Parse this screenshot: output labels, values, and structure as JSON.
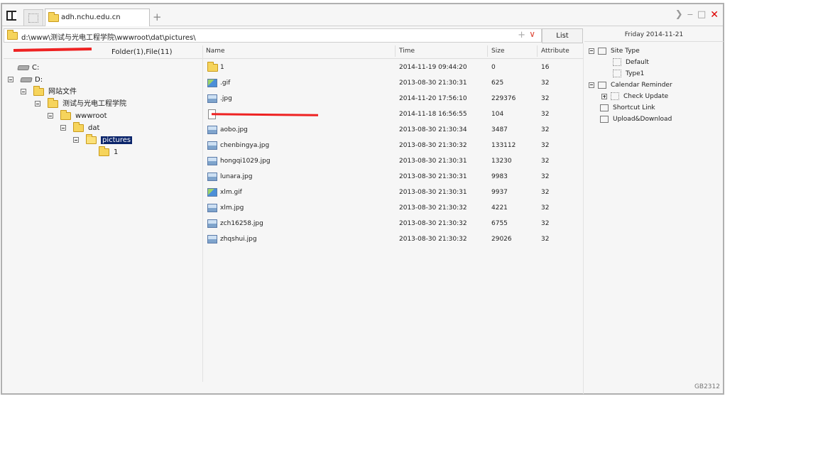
{
  "tab": {
    "title": "adh.nchu.edu.cn"
  },
  "address": {
    "path": "d:\\www\\测试与光电工程学院\\wwwroot\\dat\\pictures\\",
    "plus": "+",
    "list_button": "List"
  },
  "date_panel": "Friday 2014-11-21",
  "left": {
    "counts": "Folder(1),File(11)"
  },
  "tree": [
    {
      "label": "C:",
      "type": "drive"
    },
    {
      "label": "D:",
      "type": "drive"
    },
    {
      "label": "网站文件",
      "type": "folder"
    },
    {
      "label": "测试与光电工程学院",
      "type": "folder"
    },
    {
      "label": "wwwroot",
      "type": "folder"
    },
    {
      "label": "dat",
      "type": "folder"
    },
    {
      "label": "pictures",
      "type": "folder-selected"
    },
    {
      "label": "1",
      "type": "folder"
    }
  ],
  "columns": {
    "name": "Name",
    "time": "Time",
    "size": "Size",
    "attribute": "Attribute"
  },
  "files": [
    {
      "name": "1",
      "time": "2014-11-19 09:44:20",
      "size": "0",
      "attr": "16",
      "icon": "folder-icon"
    },
    {
      "name": ".gif",
      "time": "2013-08-30 21:30:31",
      "size": "625",
      "attr": "32",
      "icon": "gif-icon"
    },
    {
      "name": ".jpg",
      "time": "2014-11-20 17:56:10",
      "size": "229376",
      "attr": "32",
      "icon": "image-icon"
    },
    {
      "name": "",
      "time": "2014-11-18 16:56:55",
      "size": "104",
      "attr": "32",
      "icon": "document-icon"
    },
    {
      "name": "aobo.jpg",
      "time": "2013-08-30 21:30:34",
      "size": "3487",
      "attr": "32",
      "icon": "image-icon"
    },
    {
      "name": "chenbingya.jpg",
      "time": "2013-08-30 21:30:32",
      "size": "133112",
      "attr": "32",
      "icon": "image-icon"
    },
    {
      "name": "hongqi1029.jpg",
      "time": "2013-08-30 21:30:31",
      "size": "13230",
      "attr": "32",
      "icon": "image-icon"
    },
    {
      "name": "lunara.jpg",
      "time": "2013-08-30 21:30:31",
      "size": "9983",
      "attr": "32",
      "icon": "image-icon"
    },
    {
      "name": "xlm.gif",
      "time": "2013-08-30 21:30:31",
      "size": "9937",
      "attr": "32",
      "icon": "gif-icon"
    },
    {
      "name": "xlm.jpg",
      "time": "2013-08-30 21:30:32",
      "size": "4221",
      "attr": "32",
      "icon": "image-icon"
    },
    {
      "name": "zch16258.jpg",
      "time": "2013-08-30 21:30:32",
      "size": "6755",
      "attr": "32",
      "icon": "image-icon"
    },
    {
      "name": "zhqshui.jpg",
      "time": "2013-08-30 21:30:32",
      "size": "29026",
      "attr": "32",
      "icon": "image-icon"
    }
  ],
  "right_panel": [
    {
      "label": "Site Type"
    },
    {
      "label": "Default"
    },
    {
      "label": "Type1"
    },
    {
      "label": "Calendar Reminder"
    },
    {
      "label": "Check Update"
    },
    {
      "label": "Shortcut Link"
    },
    {
      "label": "Upload&Download"
    }
  ],
  "encoding": "GB2312",
  "colors": {
    "selection": "#0a246a",
    "close": "#dd0000",
    "redaction": "#ee2222"
  }
}
